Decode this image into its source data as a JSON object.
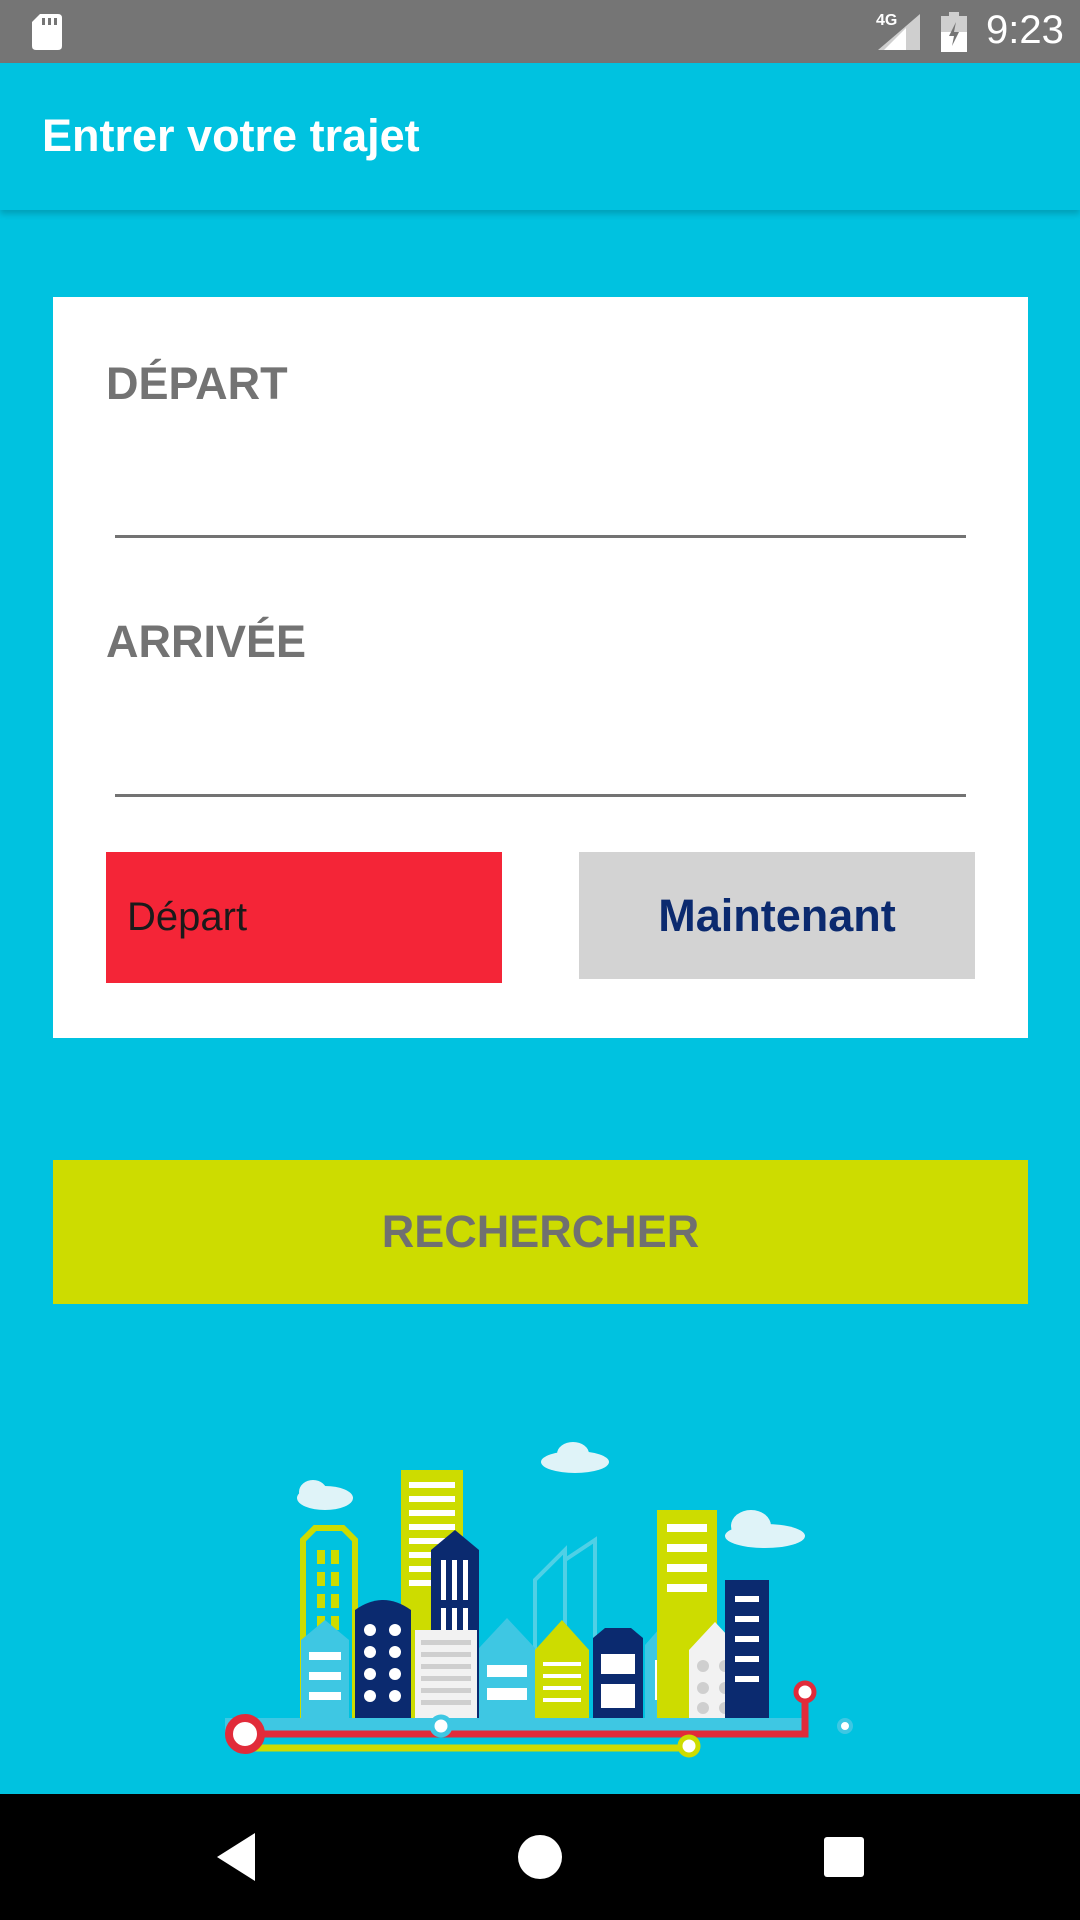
{
  "status_bar": {
    "network_label": "4G",
    "time": "9:23",
    "icons": [
      "sd-card-icon",
      "signal-icon",
      "battery-charging-icon"
    ]
  },
  "app_bar": {
    "title": "Entrer votre trajet"
  },
  "form": {
    "departure_label": "DÉPART",
    "departure_value": "",
    "arrival_label": "ARRIVÉE",
    "arrival_value": "",
    "mode_button_label": "Départ",
    "time_button_label": "Maintenant"
  },
  "search_button_label": "RECHERCHER",
  "nav_bar": {
    "icons": [
      "back-icon",
      "home-icon",
      "recents-icon"
    ]
  },
  "colors": {
    "background": "#00c2e0",
    "status_bar": "#757575",
    "mode_button": "#f42537",
    "time_button": "#d3d3d3",
    "time_button_text": "#0b2a6f",
    "search_button": "#cddc00",
    "label_text": "#737373"
  }
}
